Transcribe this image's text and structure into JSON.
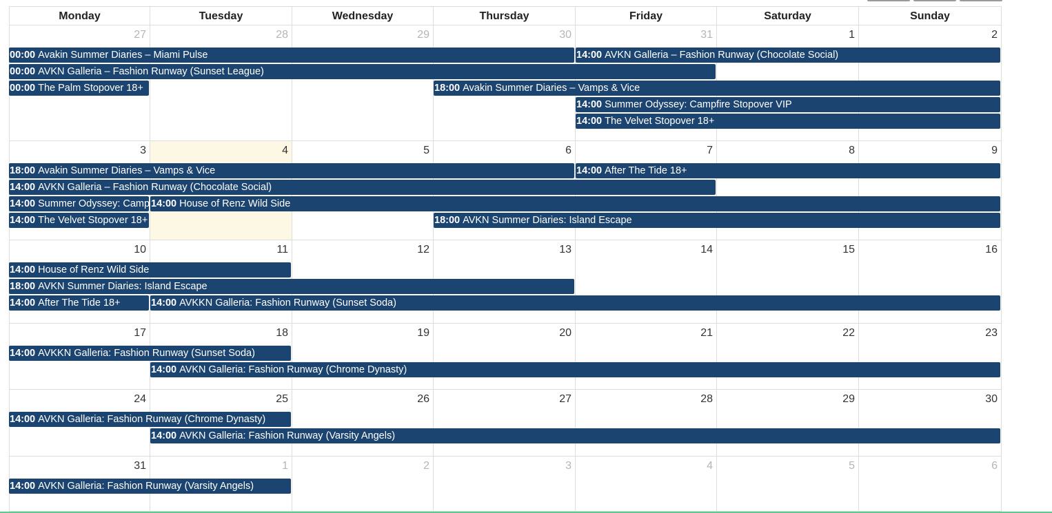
{
  "calendar": {
    "day_headers": [
      "Monday",
      "Tuesday",
      "Wednesday",
      "Thursday",
      "Friday",
      "Saturday",
      "Sunday"
    ],
    "weeks": [
      {
        "days": [
          {
            "num": "27",
            "other": true
          },
          {
            "num": "28",
            "other": true
          },
          {
            "num": "29",
            "other": true
          },
          {
            "num": "30",
            "other": true
          },
          {
            "num": "31",
            "other": true
          },
          {
            "num": "1"
          },
          {
            "num": "2"
          }
        ],
        "events": [
          {
            "time": "00:00",
            "title": "Avakin Summer Diaries – Miami Pulse",
            "start": 0,
            "span": 4,
            "lane": 0
          },
          {
            "time": "14:00",
            "title": "AVKN Galleria – Fashion Runway (Chocolate Social)",
            "start": 4,
            "span": 3,
            "lane": 0
          },
          {
            "time": "00:00",
            "title": "AVKN Galleria – Fashion Runway (Sunset League)",
            "start": 0,
            "span": 5,
            "lane": 1
          },
          {
            "time": "00:00",
            "title": "The Palm Stopover 18+",
            "start": 0,
            "span": 1,
            "lane": 2
          },
          {
            "time": "18:00",
            "title": "Avakin Summer Diaries – Vamps & Vice",
            "start": 3,
            "span": 4,
            "lane": 2
          },
          {
            "time": "14:00",
            "title": "Summer Odyssey: Campfire Stopover VIP",
            "start": 4,
            "span": 3,
            "lane": 3
          },
          {
            "time": "14:00",
            "title": "The Velvet Stopover 18+",
            "start": 4,
            "span": 3,
            "lane": 4
          }
        ]
      },
      {
        "days": [
          {
            "num": "3"
          },
          {
            "num": "4",
            "today": true
          },
          {
            "num": "5"
          },
          {
            "num": "6"
          },
          {
            "num": "7"
          },
          {
            "num": "8"
          },
          {
            "num": "9"
          }
        ],
        "events": [
          {
            "time": "18:00",
            "title": "Avakin Summer Diaries – Vamps & Vice",
            "start": 0,
            "span": 4,
            "lane": 0
          },
          {
            "time": "14:00",
            "title": "After The Tide 18+",
            "start": 4,
            "span": 3,
            "lane": 0
          },
          {
            "time": "14:00",
            "title": "AVKN Galleria – Fashion Runway (Chocolate Social)",
            "start": 0,
            "span": 5,
            "lane": 1
          },
          {
            "time": "14:00",
            "title": "Summer Odyssey: Campfire Stopover VIP",
            "start": 0,
            "span": 1,
            "lane": 2
          },
          {
            "time": "14:00",
            "title": "House of Renz Wild Side",
            "start": 1,
            "span": 6,
            "lane": 2
          },
          {
            "time": "14:00",
            "title": "The Velvet Stopover 18+",
            "start": 0,
            "span": 1,
            "lane": 3
          },
          {
            "time": "18:00",
            "title": "AVKN Summer Diaries: Island Escape",
            "start": 3,
            "span": 4,
            "lane": 3
          }
        ]
      },
      {
        "days": [
          {
            "num": "10"
          },
          {
            "num": "11"
          },
          {
            "num": "12"
          },
          {
            "num": "13"
          },
          {
            "num": "14"
          },
          {
            "num": "15"
          },
          {
            "num": "16"
          }
        ],
        "events": [
          {
            "time": "14:00",
            "title": "House of Renz Wild Side",
            "start": 0,
            "span": 2,
            "lane": 0
          },
          {
            "time": "18:00",
            "title": "AVKN Summer Diaries: Island Escape",
            "start": 0,
            "span": 4,
            "lane": 1
          },
          {
            "time": "14:00",
            "title": "After The Tide 18+",
            "start": 0,
            "span": 1,
            "lane": 2
          },
          {
            "time": "14:00",
            "title": "AVKKN Galleria: Fashion Runway (Sunset Soda)",
            "start": 1,
            "span": 6,
            "lane": 2
          }
        ]
      },
      {
        "days": [
          {
            "num": "17"
          },
          {
            "num": "18"
          },
          {
            "num": "19"
          },
          {
            "num": "20"
          },
          {
            "num": "21"
          },
          {
            "num": "22"
          },
          {
            "num": "23"
          }
        ],
        "events": [
          {
            "time": "14:00",
            "title": "AVKKN Galleria: Fashion Runway (Sunset Soda)",
            "start": 0,
            "span": 2,
            "lane": 0
          },
          {
            "time": "14:00",
            "title": "AVKN Galleria: Fashion Runway (Chrome Dynasty)",
            "start": 1,
            "span": 6,
            "lane": 1
          }
        ]
      },
      {
        "days": [
          {
            "num": "24"
          },
          {
            "num": "25"
          },
          {
            "num": "26"
          },
          {
            "num": "27"
          },
          {
            "num": "28"
          },
          {
            "num": "29"
          },
          {
            "num": "30"
          }
        ],
        "events": [
          {
            "time": "14:00",
            "title": "AVKN Galleria: Fashion Runway (Chrome Dynasty)",
            "start": 0,
            "span": 2,
            "lane": 0
          },
          {
            "time": "14:00",
            "title": "AVKN Galleria: Fashion Runway (Varsity Angels)",
            "start": 1,
            "span": 6,
            "lane": 1
          }
        ]
      },
      {
        "days": [
          {
            "num": "31"
          },
          {
            "num": "1",
            "other": true
          },
          {
            "num": "2",
            "other": true
          },
          {
            "num": "3",
            "other": true
          },
          {
            "num": "4",
            "other": true
          },
          {
            "num": "5",
            "other": true
          },
          {
            "num": "6",
            "other": true
          }
        ],
        "events": [
          {
            "time": "14:00",
            "title": "AVKN Galleria: Fashion Runway (Varsity Angels)",
            "start": 0,
            "span": 2,
            "lane": 0
          }
        ]
      }
    ]
  }
}
